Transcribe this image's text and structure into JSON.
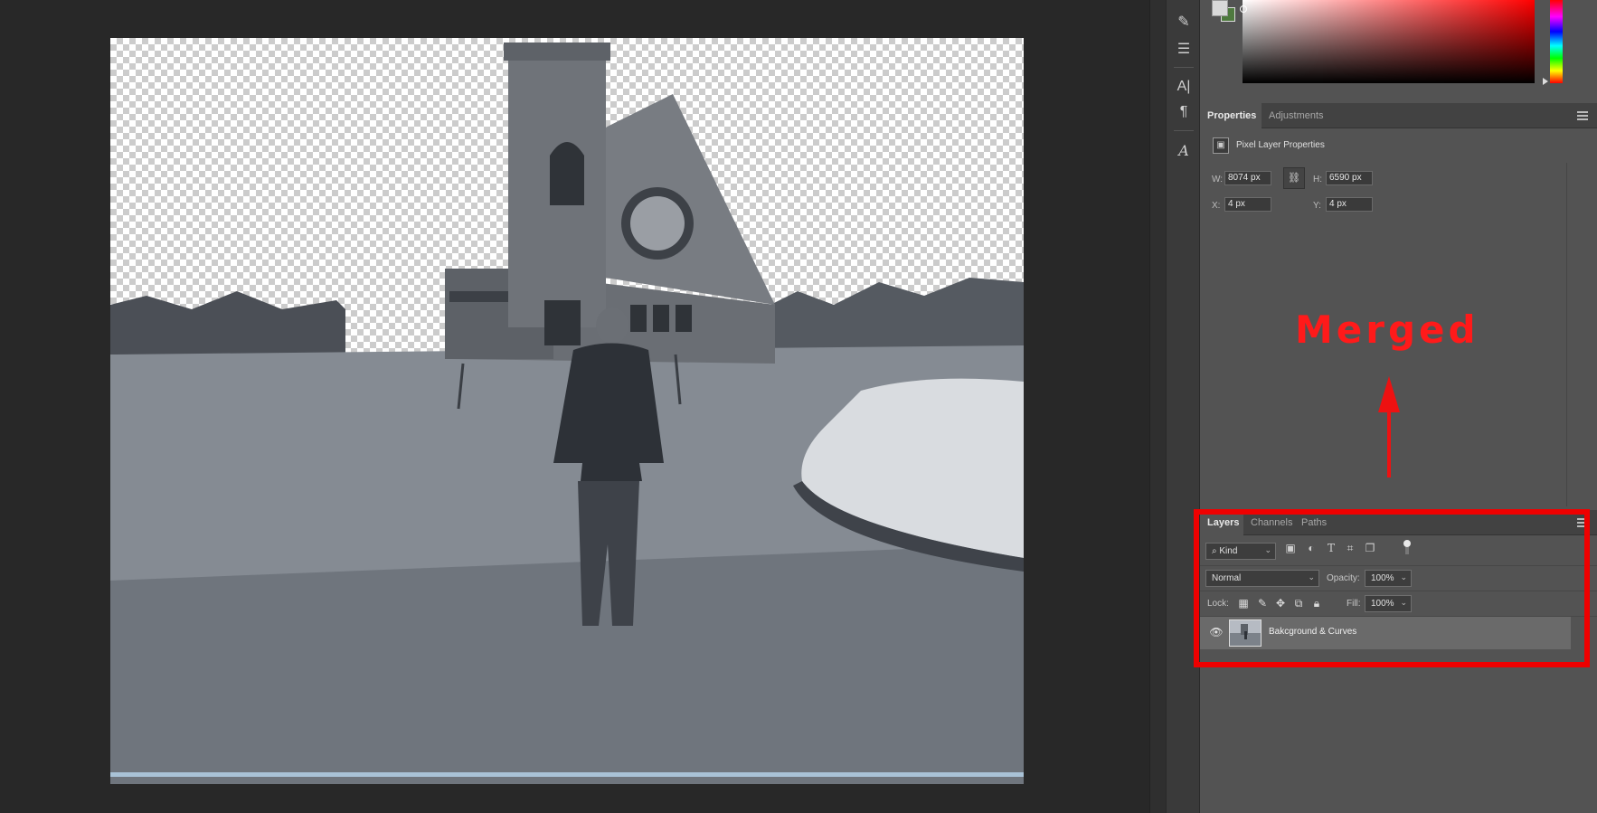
{
  "properties": {
    "tabs": [
      "Properties",
      "Adjustments"
    ],
    "title": "Pixel Layer Properties",
    "w_label": "W:",
    "w_value": "8074 px",
    "h_label": "H:",
    "h_value": "6590 px",
    "x_label": "X:",
    "x_value": "4 px",
    "y_label": "Y:",
    "y_value": "4 px"
  },
  "annotation": {
    "text": "Merged",
    "color": "#ee0000"
  },
  "layers": {
    "tabs": [
      "Layers",
      "Channels",
      "Paths"
    ],
    "filter_kind": "Kind",
    "blend_mode": "Normal",
    "opacity_label": "Opacity:",
    "opacity_value": "100%",
    "lock_label": "Lock:",
    "fill_label": "Fill:",
    "fill_value": "100%",
    "layer_name": "Bakcground & Curves"
  },
  "colors": {
    "foreground": "#d9d9d9",
    "background": "#4f7a3f",
    "panel": "#535353",
    "accent_red": "#ee0000"
  },
  "icons": {
    "tools": [
      "brush-settings-icon",
      "adjust-sliders-icon",
      "character-icon",
      "paragraph-icon",
      "glyphs-icon"
    ],
    "filters": [
      "pixel-filter-icon",
      "adjustment-filter-icon",
      "type-filter-icon",
      "shape-filter-icon",
      "smart-object-filter-icon"
    ],
    "locks": [
      "lock-transparent-icon",
      "lock-image-icon",
      "lock-position-icon",
      "lock-artboard-icon",
      "lock-all-icon"
    ]
  }
}
